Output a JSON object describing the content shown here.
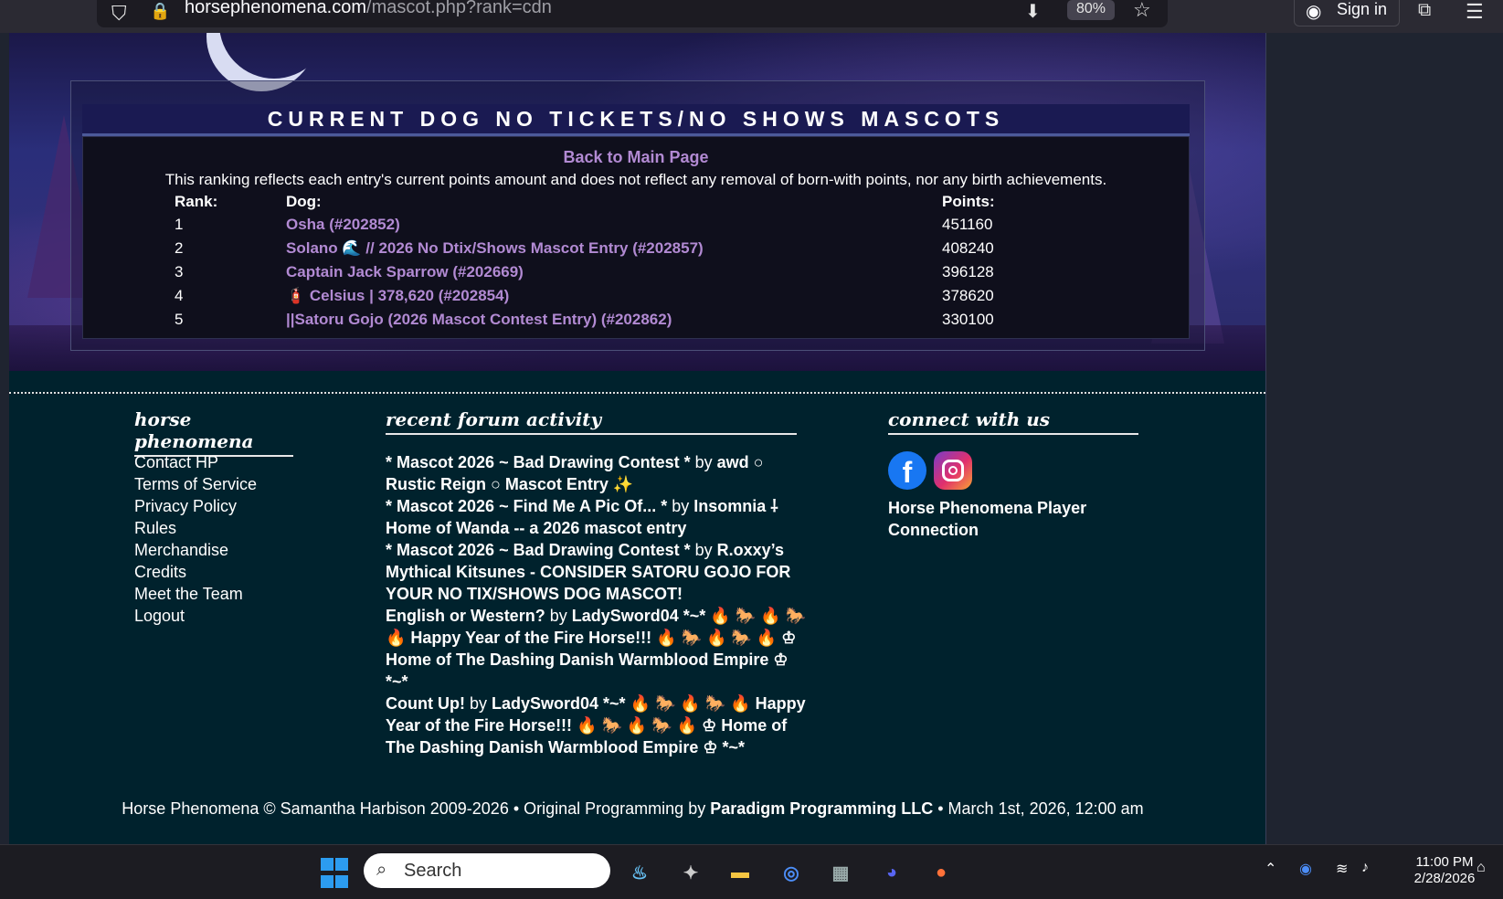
{
  "browser": {
    "url_host": "horsephenomena.com",
    "url_path": "/mascot.php?rank=cdn",
    "zoom": "80%",
    "sign_in_label": "Sign in"
  },
  "ranking": {
    "title": "CURRENT DOG NO TICKETS/NO SHOWS MASCOTS",
    "back_link": "Back to Main Page",
    "description": "This ranking reflects each entry's current points amount and does not reflect any removal of born-with points, nor any birth achievements.",
    "headers": {
      "rank": "Rank:",
      "dog": "Dog:",
      "points": "Points:"
    },
    "rows": [
      {
        "rank": "1",
        "dog": "Osha (#202852)",
        "points": "451160"
      },
      {
        "rank": "2",
        "dog": "Solano 🌊 // 2026 No Dtix/Shows Mascot Entry (#202857)",
        "points": "408240"
      },
      {
        "rank": "3",
        "dog": "Captain Jack Sparrow (#202669)",
        "points": "396128"
      },
      {
        "rank": "4",
        "dog": "🧯 Celsius | 378,620 (#202854)",
        "points": "378620"
      },
      {
        "rank": "5",
        "dog": "||Satoru Gojo (2026 Mascot Contest Entry) (#202862)",
        "points": "330100"
      }
    ]
  },
  "footer": {
    "col1_heading": "horse phenomena",
    "links": [
      "Contact HP",
      "Terms of Service",
      "Privacy Policy",
      "Rules",
      "Merchandise",
      "Credits",
      "Meet the Team",
      "Logout"
    ],
    "col2_heading": "recent forum activity",
    "forum": [
      {
        "topic": "* Mascot 2026 ~ Bad Drawing Contest *",
        "by": " by ",
        "user": "awd ○ Rustic Reign ○ Mascot Entry ✨"
      },
      {
        "topic": "* Mascot 2026 ~ Find Me A Pic Of... *",
        "by": " by ",
        "user": "Insomnia ⸸ Home of Wanda -- a 2026 mascot entry"
      },
      {
        "topic": "* Mascot 2026 ~ Bad Drawing Contest *",
        "by": " by ",
        "user": "R.oxxy’s Mythical Kitsunes - CONSIDER SATORU GOJO FOR YOUR NO TIX/SHOWS DOG MASCOT!"
      },
      {
        "topic": "English or Western?",
        "by": " by ",
        "user": "LadySword04 *~* 🔥 🐎 🔥 🐎 🔥 Happy Year of the Fire Horse!!! 🔥 🐎 🔥 🐎 🔥 ♔ Home of The Dashing Danish Warmblood Empire ♔ *~*"
      },
      {
        "topic": "Count Up!",
        "by": " by ",
        "user": "LadySword04 *~* 🔥 🐎 🔥 🐎 🔥 Happy Year of the Fire Horse!!! 🔥 🐎 🔥 🐎 🔥 ♔ Home of The Dashing Danish Warmblood Empire ♔ *~*"
      }
    ],
    "col3_heading": "connect with us",
    "player_connection": "Horse Phenomena Player Connection",
    "copyright_pre": "Horse Phenomena © Samantha Harbison 2009-2026  •  Original Programming by ",
    "copyright_company": "Paradigm Programming LLC",
    "copyright_post": "  •  March 1st, 2026, 12:00 am"
  },
  "taskbar": {
    "search_label": "Search",
    "time": "11:00 PM",
    "date": "2/28/2026"
  }
}
